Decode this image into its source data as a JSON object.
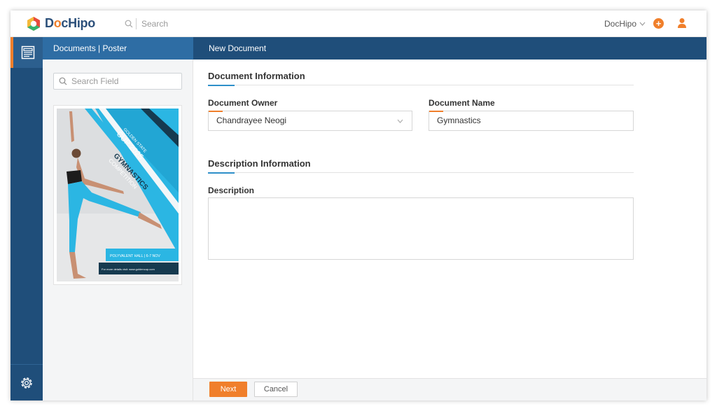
{
  "app": {
    "brand_prefix": "D",
    "brand_o": "o",
    "brand_suffix": "cHipo",
    "search_placeholder": "Search",
    "user_menu_label": "DocHipo",
    "add_icon": "plus-circle-icon",
    "user_icon": "user-icon"
  },
  "sidebar": {
    "items": [
      {
        "name": "documents",
        "icon": "document-icon",
        "active": true
      },
      {
        "name": "settings",
        "icon": "gear-icon",
        "active": false
      }
    ]
  },
  "panel": {
    "breadcrumb": "Documents | Poster",
    "search_placeholder": "Search Field",
    "template": {
      "arch_text": "GOLDEN STATE",
      "cup_text": "CUP 2025",
      "event_line1": "GYMNASTICS",
      "event_line2": "COMPETITION",
      "venue": "POLYVALENT HALL | 6-7 NOV",
      "details": "For more details visit: www.goldencup.com"
    }
  },
  "main": {
    "header_title": "New Document",
    "doc_info_title": "Document Information",
    "owner_label": "Document Owner",
    "owner_value": "Chandrayee Neogi",
    "name_label": "Document Name",
    "name_value": "Gymnastics",
    "desc_info_title": "Description Information",
    "description_label": "Description",
    "description_value": ""
  },
  "footer": {
    "next_label": "Next",
    "cancel_label": "Cancel"
  },
  "colors": {
    "accent_orange": "#f07f2b",
    "nav_blue": "#1f4e7a",
    "header_blue": "#2e6da4",
    "poster_cyan": "#2bb6e3"
  }
}
